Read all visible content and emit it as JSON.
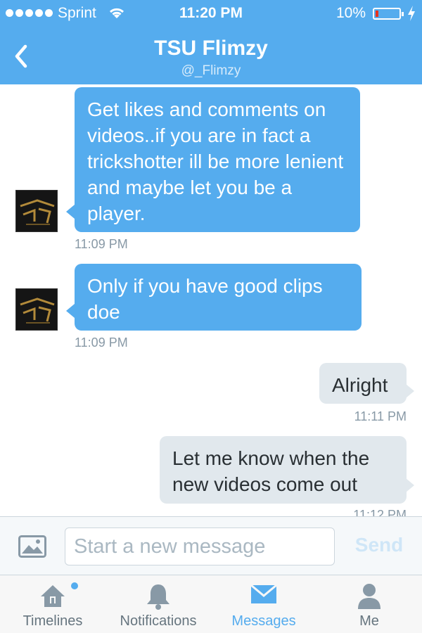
{
  "status_bar": {
    "carrier": "Sprint",
    "time": "11:20 PM",
    "battery": "10%",
    "battery_level": 0.1
  },
  "nav": {
    "title": "TSU Flimzy",
    "handle": "@_Flimzy"
  },
  "messages": [
    {
      "from": "them",
      "text": "Get likes and comments on videos..if you are in fact a trickshotter ill be more lenient and maybe let you be a player.",
      "time": "11:09 PM"
    },
    {
      "from": "them",
      "text": "Only if you have good clips doe",
      "time": "11:09 PM"
    },
    {
      "from": "me",
      "text": "Alright",
      "time": "11:11 PM"
    },
    {
      "from": "me",
      "text": "Let me know when the new videos come out",
      "time": "11:12 PM"
    }
  ],
  "composer": {
    "placeholder": "Start a new message",
    "send_label": "Send"
  },
  "tabs": [
    {
      "label": "Timelines",
      "icon": "home-icon",
      "has_notification_dot": true
    },
    {
      "label": "Notifications",
      "icon": "bell-icon"
    },
    {
      "label": "Messages",
      "icon": "envelope-icon",
      "active": true
    },
    {
      "label": "Me",
      "icon": "person-icon"
    }
  ],
  "colors": {
    "brand": "#55acee",
    "incoming_bubble": "#55acee",
    "outgoing_bubble": "#e1e8ed",
    "battery_low": "#e8321f"
  }
}
